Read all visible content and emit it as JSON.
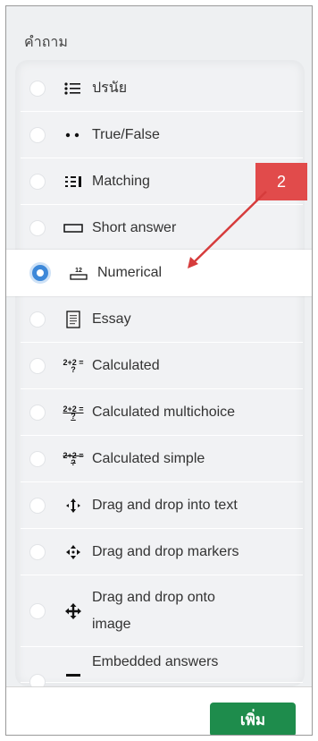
{
  "panel": {
    "title": "คำถาม"
  },
  "question_types": [
    {
      "label": "ปรนัย",
      "icon": "multiple-choice-list-icon",
      "selected": false
    },
    {
      "label": "True/False",
      "icon": "true-false-dots-icon",
      "selected": false
    },
    {
      "label": "Matching",
      "icon": "matching-icon",
      "selected": false
    },
    {
      "label": "Short answer",
      "icon": "short-answer-box-icon",
      "selected": false
    },
    {
      "label": "Numerical",
      "icon": "numerical-icon",
      "icon_text": "12",
      "selected": true
    },
    {
      "label": "Essay",
      "icon": "essay-document-icon",
      "selected": false
    },
    {
      "label": "Calculated",
      "icon": "calculated-icon",
      "icon_text": "2+2 = ?",
      "selected": false
    },
    {
      "label": "Calculated multichoice",
      "icon": "calculated-multichoice-icon",
      "icon_text": "2+2 = ?",
      "selected": false
    },
    {
      "label": "Calculated simple",
      "icon": "calculated-simple-icon",
      "icon_text": "2+2 = ?",
      "selected": false
    },
    {
      "label": "Drag and drop into text",
      "icon": "drag-drop-text-icon",
      "selected": false
    },
    {
      "label": "Drag and drop markers",
      "icon": "drag-drop-markers-icon",
      "selected": false
    },
    {
      "label": "Drag and drop onto image",
      "label_lines": [
        "Drag and drop onto",
        "image"
      ],
      "icon": "drag-drop-image-icon",
      "selected": false
    },
    {
      "label": "Embedded answers",
      "icon": "embedded-answers-icon",
      "selected": false
    }
  ],
  "footer": {
    "add_button_label": "เพิ่ม"
  },
  "annotation": {
    "badge_text": "2",
    "color": "#e14b4b"
  },
  "colors": {
    "accent": "#3d88d9",
    "button": "#1e8c4c"
  }
}
